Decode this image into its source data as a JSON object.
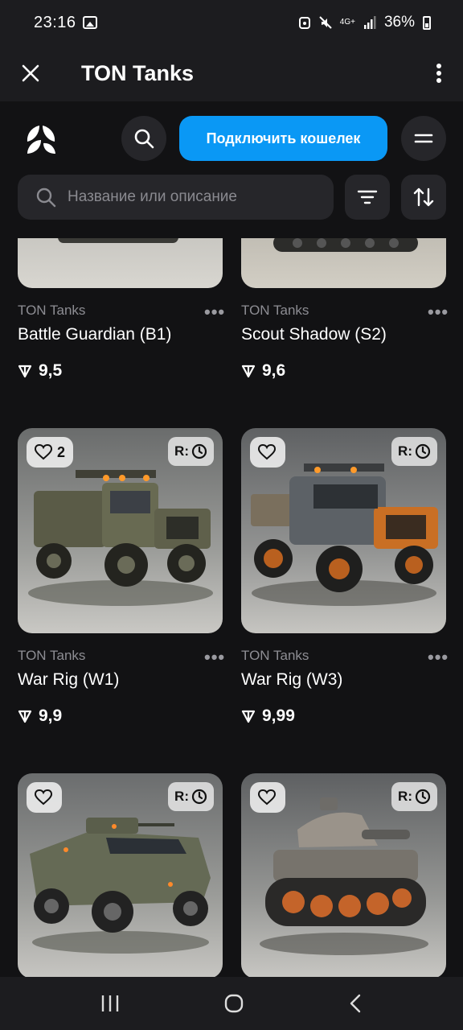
{
  "status": {
    "time": "23:16",
    "network": "4G+",
    "battery": "36%"
  },
  "appbar": {
    "title": "TON Tanks",
    "close_icon": "close-icon",
    "menu_icon": "more-vert-icon"
  },
  "header": {
    "connect_label": "Подключить кошелек",
    "search_placeholder": "Название или описание",
    "accent": "#0a98f5"
  },
  "items": [
    {
      "collection": "TON Tanks",
      "name": "Battle Guardian (B1)",
      "price": "9,5"
    },
    {
      "collection": "TON Tanks",
      "name": "Scout Shadow (S2)",
      "price": "9,6"
    },
    {
      "collection": "TON Tanks",
      "name": "War Rig (W1)",
      "price": "9,9",
      "likes": "2",
      "badge": "R:"
    },
    {
      "collection": "TON Tanks",
      "name": "War Rig (W3)",
      "price": "9,99",
      "badge": "R:"
    },
    {
      "badge": "R:"
    },
    {
      "badge": "R:"
    }
  ]
}
